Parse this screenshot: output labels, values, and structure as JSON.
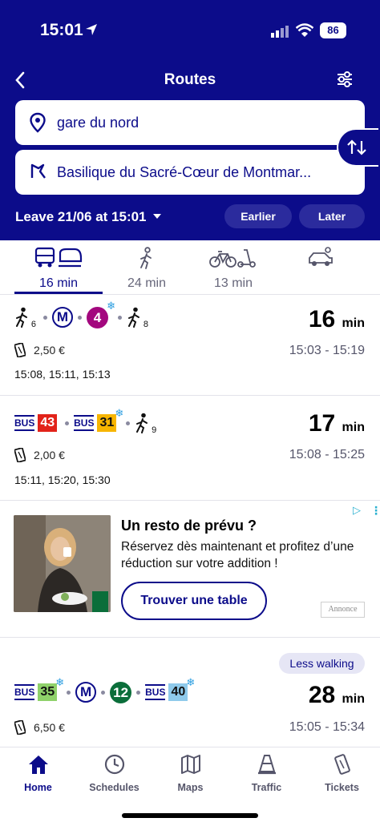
{
  "status_bar": {
    "time": "15:01",
    "battery": "86"
  },
  "header": {
    "title": "Routes",
    "from": "gare du nord",
    "to": "Basilique du Sacré-Cœur de Montmar...",
    "leave": "Leave 21/06 at 15:01",
    "earlier": "Earlier",
    "later": "Later"
  },
  "modes": [
    {
      "label": "16 min",
      "icon": "transit-icon"
    },
    {
      "label": "24 min",
      "icon": "walk-icon"
    },
    {
      "label": "13 min",
      "icon": "bike-scooter-icon"
    },
    {
      "label": "",
      "icon": "car-icon"
    }
  ],
  "routes": [
    {
      "walk_start": "6",
      "metro_line": "4",
      "walk_end": "8",
      "duration": "16",
      "unit": "min",
      "price": "2,50 €",
      "span": "15:03 - 15:19",
      "departures": "15:08, 15:11, 15:13"
    },
    {
      "bus1": "43",
      "bus2": "31",
      "walk_end": "9",
      "duration": "17",
      "unit": "min",
      "price": "2,00 €",
      "span": "15:08 - 15:25",
      "departures": "15:11, 15:20, 15:30"
    },
    {
      "tag": "Less walking",
      "bus1": "35",
      "metro_line": "12",
      "bus2": "40",
      "duration": "28",
      "unit": "min",
      "price": "6,50 €",
      "span": "15:05 - 15:34"
    }
  ],
  "ad": {
    "title": "Un resto de prévu ?",
    "text": "Réservez dès maintenant et profitez d’une réduction sur votre addition !",
    "button": "Trouver une table",
    "badge": "Annonce"
  },
  "labels": {
    "bus": "BUS",
    "metro": "M"
  },
  "tabs": [
    {
      "label": "Home"
    },
    {
      "label": "Schedules"
    },
    {
      "label": "Maps"
    },
    {
      "label": "Traffic"
    },
    {
      "label": "Tickets"
    }
  ],
  "colors": {
    "brand": "#0c0c8a",
    "metro4": "#a3077e",
    "metro12": "#0b6e3a",
    "bus43": "#e2231a",
    "bus31": "#f7b500",
    "bus35": "#8fd16a",
    "bus40": "#8fcaeb"
  }
}
